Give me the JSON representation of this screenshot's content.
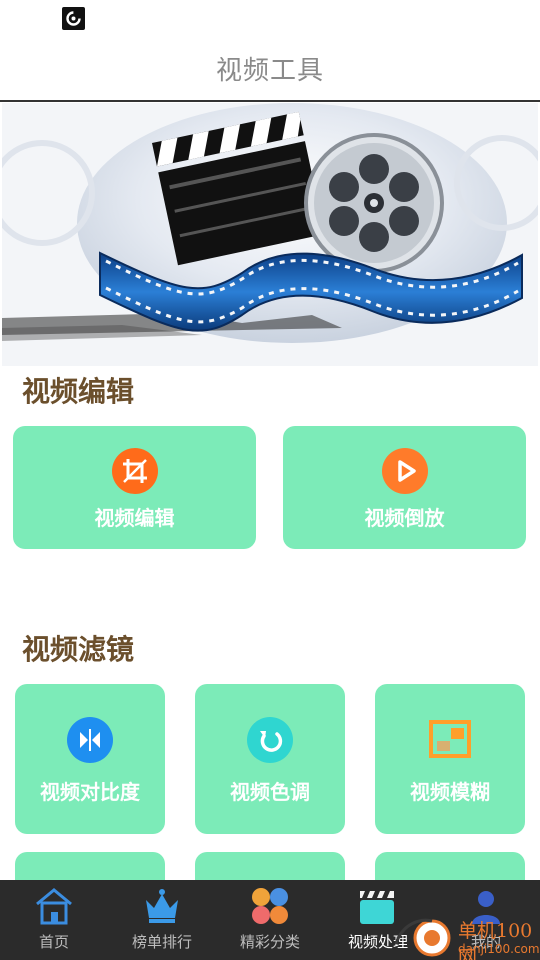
{
  "header": {
    "title": "视频工具"
  },
  "sections": {
    "edit": {
      "title": "视频编辑",
      "cards": [
        {
          "label": "视频编辑",
          "icon": "crop-icon",
          "color": "#ff6b1a"
        },
        {
          "label": "视频倒放",
          "icon": "play-icon",
          "color": "#ff7b2a"
        }
      ]
    },
    "filter": {
      "title": "视频滤镜",
      "cards": [
        {
          "label": "视频对比度",
          "icon": "mirror-icon",
          "color": "#1e8ff0"
        },
        {
          "label": "视频色调",
          "icon": "rotate-icon",
          "color": "#2fd6d0"
        },
        {
          "label": "视频模糊",
          "icon": "picture-in-picture-icon",
          "color": "#ff9f2a"
        }
      ]
    }
  },
  "tabs": [
    {
      "label": "首页",
      "icon": "home-icon"
    },
    {
      "label": "榜单排行",
      "icon": "crown-icon"
    },
    {
      "label": "精彩分类",
      "icon": "category-icon"
    },
    {
      "label": "视频处理",
      "icon": "clapperboard-icon",
      "active": true
    },
    {
      "label": "我的",
      "icon": "user-icon"
    }
  ],
  "watermark": {
    "text": "单机100网",
    "url": "danji100.com"
  },
  "colors": {
    "card": "#7cebb8",
    "section_title": "#6b4f2c",
    "tabbar": "#2b2b2b"
  }
}
